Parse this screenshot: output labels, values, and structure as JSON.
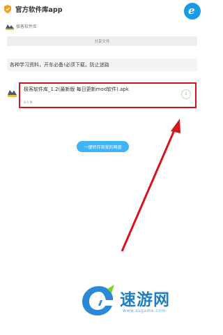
{
  "header": {
    "app_title": "官方软件库app"
  },
  "sharer": {
    "name": "极客软件库"
  },
  "share": {
    "header_label": "分享文件"
  },
  "description": {
    "text": "各种学习资料，开车必备!必须下载，防止迷路"
  },
  "file": {
    "name": "极客软件库_1.2(最新版 每日更新mod软件).apk",
    "size": "8.5 M"
  },
  "actions": {
    "save_label": "一键转存到我的网盘"
  },
  "watermark": {
    "name": "速游网",
    "url": "www.sugame.com"
  },
  "colors": {
    "highlight_border": "#d6141e",
    "arrow": "#d6141e",
    "accent_blue": "#3fb3f6",
    "watermark_blue": "#1f7fc4"
  },
  "icons": {
    "top_left": "shield-icon",
    "top_right": "browser-logo-icon",
    "file": "apk-file-icon",
    "download": "download-icon"
  }
}
